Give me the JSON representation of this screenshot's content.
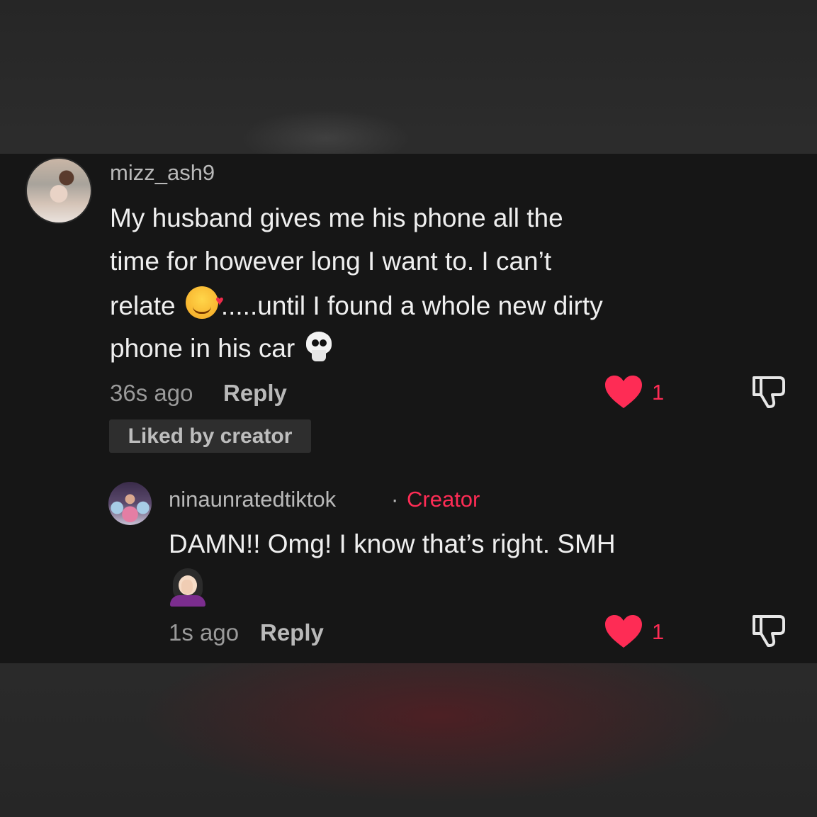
{
  "comments": [
    {
      "username": "mizz_ash9",
      "lines": [
        "My husband gives me his phone all the",
        "time for however long I want to. I can’t",
        "relate",
        ".....until I found a whole new dirty",
        "phone in his car"
      ],
      "emojis": [
        "smiling-face-with-hearts",
        "skull"
      ],
      "time": "36s ago",
      "reply_label": "Reply",
      "like_count": "1",
      "badge": "Liked by creator"
    },
    {
      "username": "ninaunratedtiktok",
      "separator": "·",
      "creator_label": "Creator",
      "lines": [
        "DAMN!! Omg! I know that’s right. SMH"
      ],
      "emojis": [
        "woman-facepalming"
      ],
      "time": "1s ago",
      "reply_label": "Reply",
      "like_count": "1"
    }
  ],
  "colors": {
    "accent": "#fe2c55",
    "panel": "#161616",
    "text": "#efefef",
    "muted": "#9a9a9a"
  },
  "icons": [
    "heart-icon",
    "dislike-icon"
  ]
}
